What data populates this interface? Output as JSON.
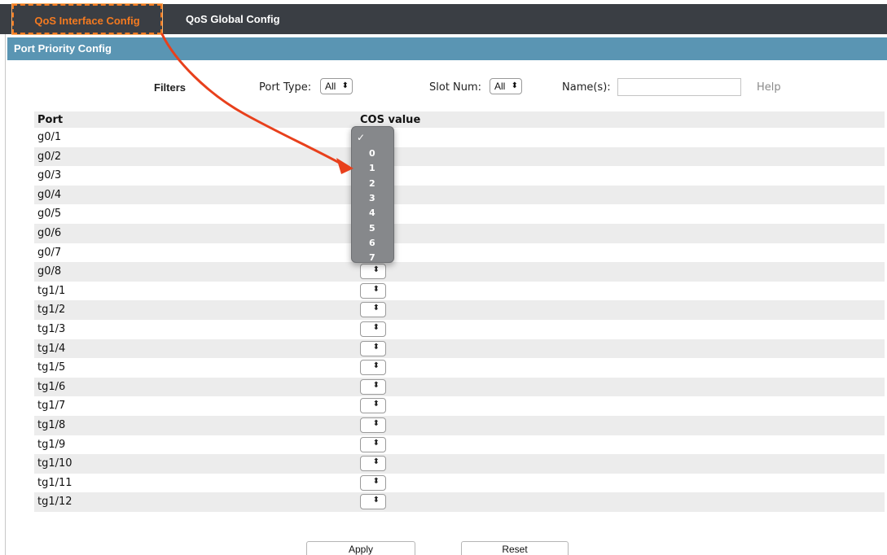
{
  "tabs": [
    {
      "label": "QoS Interface Config",
      "active": true
    },
    {
      "label": "QoS Global Config",
      "active": false
    }
  ],
  "section_title": "Port Priority Config",
  "filters": {
    "label": "Filters",
    "port_type_label": "Port Type:",
    "port_type_value": "All",
    "slot_num_label": "Slot Num:",
    "slot_num_value": "All",
    "names_label": "Name(s):",
    "names_value": "",
    "help": "Help"
  },
  "table": {
    "headers": [
      "Port",
      "COS value"
    ],
    "rows": [
      "g0/1",
      "g0/2",
      "g0/3",
      "g0/4",
      "g0/5",
      "g0/6",
      "g0/7",
      "g0/8",
      "tg1/1",
      "tg1/2",
      "tg1/3",
      "tg1/4",
      "tg1/5",
      "tg1/6",
      "tg1/7",
      "tg1/8",
      "tg1/9",
      "tg1/10",
      "tg1/11",
      "tg1/12"
    ]
  },
  "cos_dropdown": {
    "checkmark": "✓",
    "options": [
      "0",
      "1",
      "2",
      "3",
      "4",
      "5",
      "6",
      "7"
    ]
  },
  "buttons": {
    "apply": "Apply",
    "reset": "Reset"
  },
  "colors": {
    "accent": "#f47a20",
    "header_bar": "#5a95b3",
    "nav_bg": "#3a3e44",
    "annotation_arrow": "#e8401c"
  }
}
